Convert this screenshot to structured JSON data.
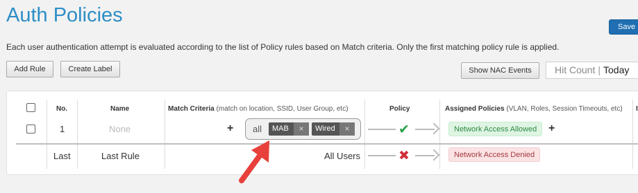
{
  "page": {
    "title": "Auth Policies",
    "save_label": "Save",
    "description": "Each user authentication attempt is evaluated according to the list of Policy rules based on Match criteria. Only the first matching policy rule is applied."
  },
  "toolbar": {
    "add_rule": "Add Rule",
    "create_label": "Create Label",
    "show_nac_events": "Show NAC Events",
    "hit_count_label": "Hit Count",
    "hit_count_separator": "|",
    "hit_count_period": "Today"
  },
  "table": {
    "headers": {
      "no": "No.",
      "name": "Name",
      "match_criteria": "Match Criteria",
      "match_criteria_sub": "(match on location, SSID, User Group, etc)",
      "policy": "Policy",
      "assigned_policies": "Assigned Policies",
      "assigned_policies_sub": "(VLAN, Roles, Session Timeouts, etc)",
      "extra": "I"
    },
    "rows": [
      {
        "no": "1",
        "name": "None",
        "criteria_prefix": "all",
        "criteria_tags": [
          "MAB",
          "Wired"
        ],
        "policy_status": "allow",
        "assigned_policy": "Network Access Allowed"
      },
      {
        "no": "Last",
        "name": "Last Rule",
        "criteria_text": "All Users",
        "policy_status": "deny",
        "assigned_policy": "Network Access Denied"
      }
    ]
  },
  "icons": {
    "add": "plus-icon",
    "remove_tag": "close-icon",
    "allow": "checkmark-icon",
    "deny": "x-icon",
    "flow": "arrow-right-icon",
    "callout": "red-arrow-icon"
  },
  "colors": {
    "accent": "#2d8ec6",
    "save_button": "#1f6fb2",
    "allow": "#2aa14a",
    "deny": "#d0303a",
    "callout_arrow": "#e8403a"
  }
}
